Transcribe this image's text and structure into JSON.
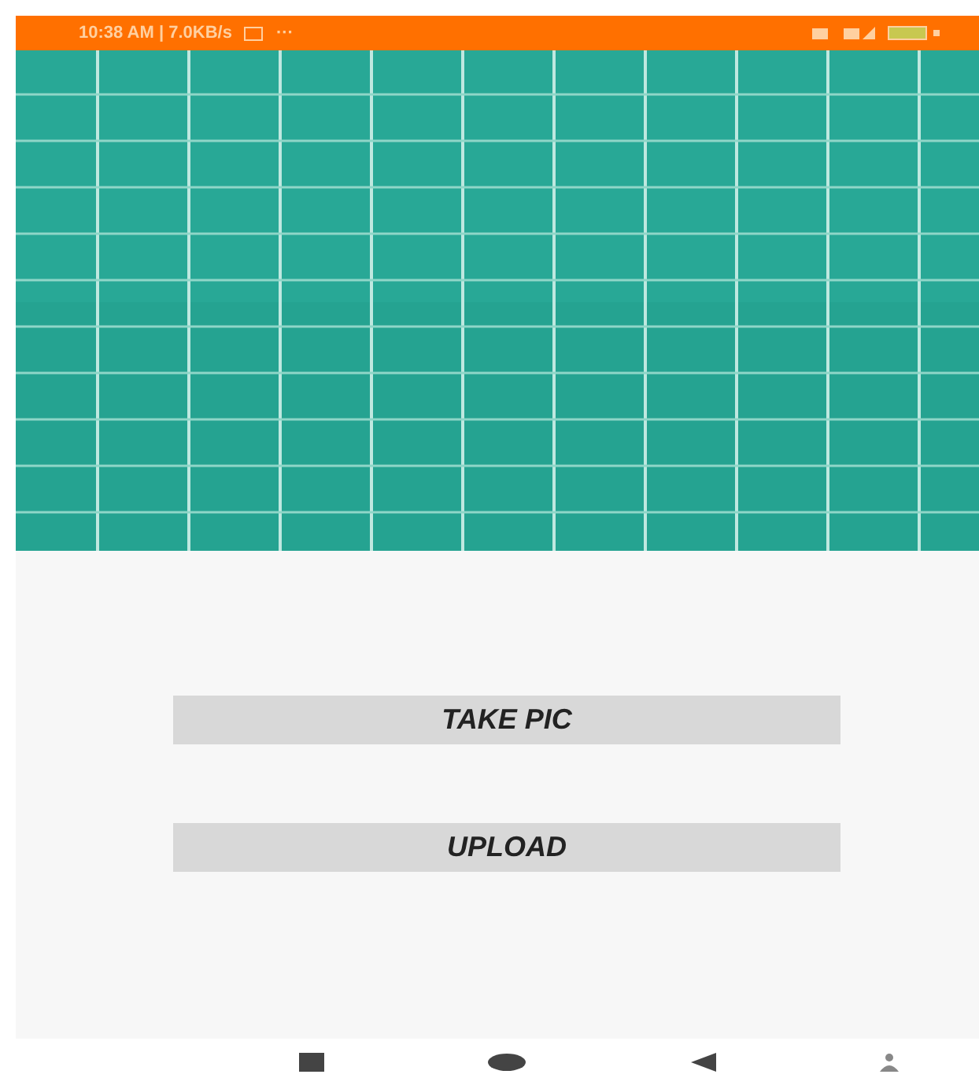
{
  "status_bar": {
    "time": "10:38 AM | 7.0KB/s",
    "dots": "···"
  },
  "buttons": [
    {
      "label": "TAKE PIC"
    },
    {
      "label": "UPLOAD"
    }
  ]
}
